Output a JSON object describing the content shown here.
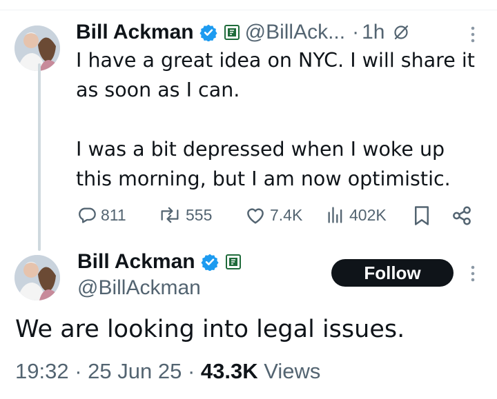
{
  "reply_tweet": {
    "author_name": "Bill Ackman",
    "handle": "@BillAck...",
    "separator": "·",
    "time": "1h",
    "text_lines": [
      "I have a great idea on NYC. I will share it",
      "as soon as I can.",
      "I was a bit depressed when I woke up",
      "this morning, but I am now optimistic."
    ],
    "stats": {
      "replies": "811",
      "reposts": "555",
      "likes": "7.4K",
      "views": "402K"
    }
  },
  "main_tweet": {
    "author_name": "Bill Ackman",
    "handle": "@BillAckman",
    "follow_label": "Follow",
    "text": "We are looking into legal issues.",
    "time": "19:32",
    "dot1": "·",
    "date": "25 Jun 25",
    "dot2": "·",
    "views_count": "43.3K",
    "views_label": "Views"
  },
  "colors": {
    "verified": "#1d9bf0",
    "affiliate_badge": "#1f6b3a",
    "muted": "#536471",
    "follow_bg": "#0f1419"
  }
}
